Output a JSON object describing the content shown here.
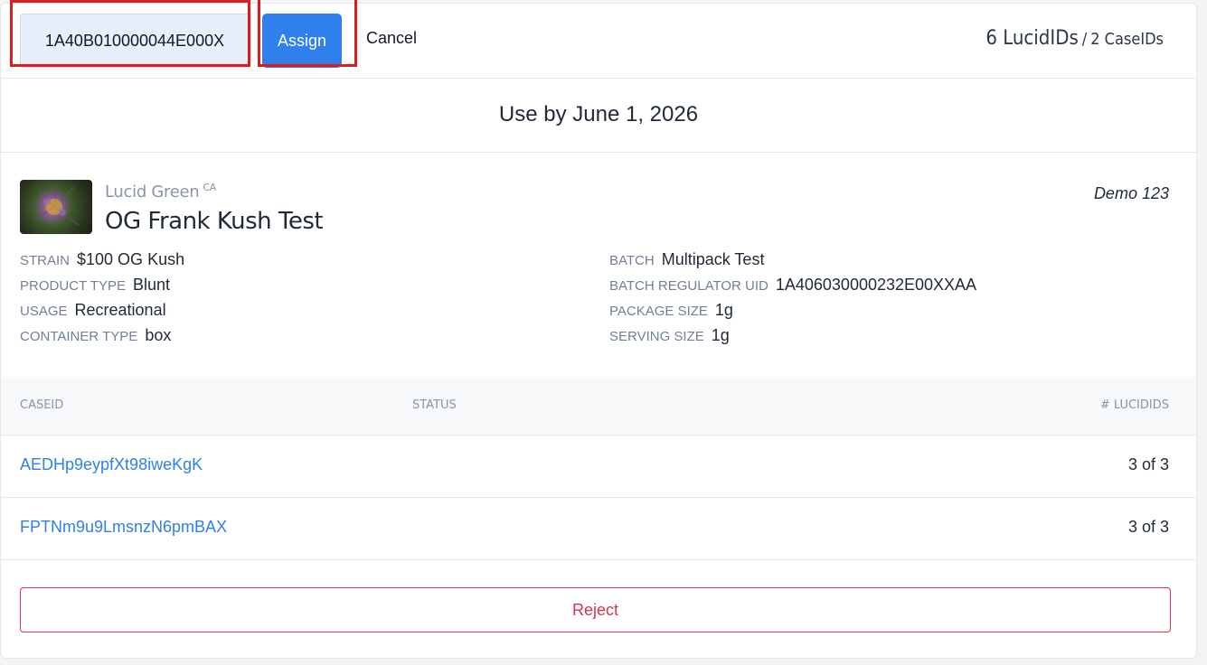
{
  "topbar": {
    "uid_input_value": "1A40B010000044E000X",
    "assign_label": "Assign",
    "cancel_label": "Cancel",
    "lucid_count": "6 LucidIDs",
    "separator": "/",
    "case_count": "2 CaseIDs"
  },
  "use_by": "Use by June 1, 2026",
  "product": {
    "brand": "Lucid Green",
    "brand_region": "CA",
    "name": "OG Frank Kush Test",
    "tag": "Demo 123",
    "image_icon": "cannabis-flower-photo"
  },
  "attributes_left": [
    {
      "label": "STRAIN",
      "value": "$100 OG Kush"
    },
    {
      "label": "PRODUCT TYPE",
      "value": "Blunt"
    },
    {
      "label": "USAGE",
      "value": "Recreational"
    },
    {
      "label": "CONTAINER TYPE",
      "value": "box"
    }
  ],
  "attributes_right": [
    {
      "label": "BATCH",
      "value": "Multipack Test"
    },
    {
      "label": "BATCH REGULATOR UID",
      "value": "1A406030000232E00XXAA"
    },
    {
      "label": "PACKAGE SIZE",
      "value": "1g"
    },
    {
      "label": "SERVING SIZE",
      "value": "1g"
    }
  ],
  "table": {
    "headers": {
      "caseid": "CaseID",
      "status": "Status",
      "lucidids": "# LucidIDs"
    },
    "rows": [
      {
        "caseid": "AEDHp9eypfXt98iweKgK",
        "status": "",
        "count": "3 of 3"
      },
      {
        "caseid": "FPTNm9u9LmsnzN6pmBAX",
        "status": "",
        "count": "3 of 3"
      }
    ]
  },
  "reject_label": "Reject",
  "colors": {
    "accent": "#2f80ed",
    "highlight": "#e01b1b",
    "danger": "#d6344c"
  }
}
